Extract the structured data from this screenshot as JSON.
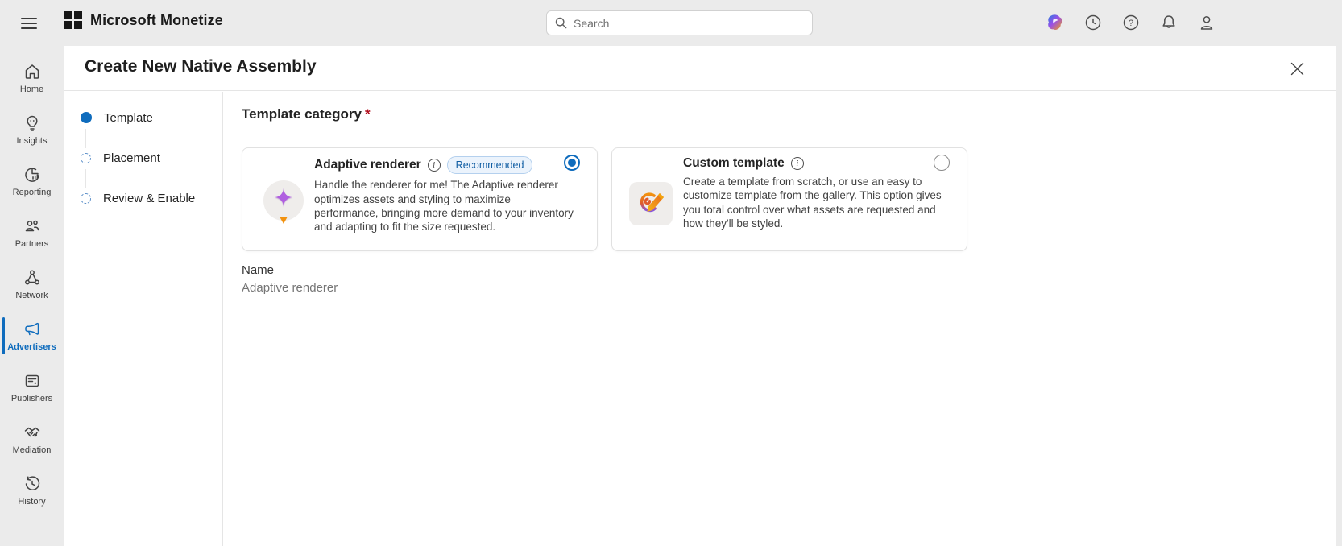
{
  "topbar": {
    "brand": "Microsoft Monetize",
    "search_placeholder": "Search",
    "icons": [
      {
        "name": "copilot-icon"
      },
      {
        "name": "recent-activity-icon"
      },
      {
        "name": "help-icon"
      },
      {
        "name": "notifications-icon"
      },
      {
        "name": "account-icon"
      }
    ]
  },
  "sidebar": {
    "items": [
      {
        "label": "Home",
        "icon": "home-icon",
        "active": false
      },
      {
        "label": "Insights",
        "icon": "insights-icon",
        "active": false
      },
      {
        "label": "Reporting",
        "icon": "reporting-icon",
        "active": false
      },
      {
        "label": "Partners",
        "icon": "partners-icon",
        "active": false
      },
      {
        "label": "Network",
        "icon": "network-icon",
        "active": false
      },
      {
        "label": "Advertisers",
        "icon": "advertisers-icon",
        "active": true
      },
      {
        "label": "Publishers",
        "icon": "publishers-icon",
        "active": false
      },
      {
        "label": "Mediation",
        "icon": "mediation-icon",
        "active": false
      },
      {
        "label": "History",
        "icon": "history-icon",
        "active": false
      }
    ]
  },
  "page": {
    "title": "Create New Native Assembly"
  },
  "wizard": {
    "steps": [
      {
        "label": "Template",
        "state": "active"
      },
      {
        "label": "Placement",
        "state": "upcoming"
      },
      {
        "label": "Review & Enable",
        "state": "upcoming"
      }
    ]
  },
  "form": {
    "section_title": "Template category",
    "required_marker": "*",
    "options": [
      {
        "title": "Adaptive renderer",
        "badge": "Recommended",
        "selected": true,
        "description": "Handle the renderer for me! The Adaptive renderer optimizes assets and styling to maximize performance, bringing more demand to your inventory and adapting to fit the size requested."
      },
      {
        "title": "Custom template",
        "selected": false,
        "description": "Create a template from scratch, or use an easy to customize template from the gallery. This option gives you total control over what assets are requested and how they'll be styled."
      }
    ],
    "name_label": "Name",
    "name_value": "Adaptive renderer"
  },
  "colors": {
    "accent": "#0f6cbd",
    "badge_text": "#115ea3",
    "badge_bg": "#ebf3fc",
    "badge_border": "#b4d0ee",
    "required_marker": "#b10e1c",
    "chrome_bg": "#ebebeb"
  }
}
